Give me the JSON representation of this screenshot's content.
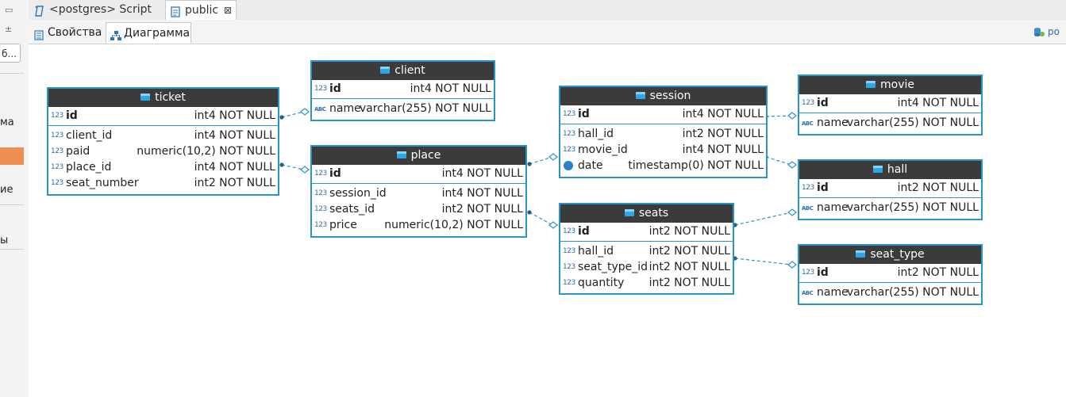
{
  "editor_tabs": [
    {
      "label": "<postgres> Script"
    },
    {
      "label": "public",
      "close": "⊠"
    }
  ],
  "sub_tabs": [
    {
      "label": "Свойства"
    },
    {
      "label": "Диаграмма"
    }
  ],
  "right_label": "ро",
  "left_panel": {
    "input_value": "б...",
    "items": [
      "ма",
      "ие",
      "ы"
    ]
  },
  "type_icons": {
    "num": "123",
    "text": "ABC"
  },
  "entities": {
    "ticket": {
      "name": "ticket",
      "pk": {
        "name": "id",
        "type": "int4 NOT NULL"
      },
      "cols": [
        {
          "name": "client_id",
          "type": "int4 NOT NULL"
        },
        {
          "name": "paid",
          "type": "numeric(10,2) NOT NULL"
        },
        {
          "name": "place_id",
          "type": "int4 NOT NULL"
        },
        {
          "name": "seat_number",
          "type": "int2 NOT NULL"
        }
      ]
    },
    "client": {
      "name": "client",
      "pk": {
        "name": "id",
        "type": "int4 NOT NULL"
      },
      "cols": [
        {
          "name": "name",
          "type": "varchar(255) NOT NULL"
        }
      ]
    },
    "place": {
      "name": "place",
      "pk": {
        "name": "id",
        "type": "int4 NOT NULL"
      },
      "cols": [
        {
          "name": "session_id",
          "type": "int4 NOT NULL"
        },
        {
          "name": "seats_id",
          "type": "int2 NOT NULL"
        },
        {
          "name": "price",
          "type": "numeric(10,2) NOT NULL"
        }
      ]
    },
    "session": {
      "name": "session",
      "pk": {
        "name": "id",
        "type": "int4 NOT NULL"
      },
      "cols": [
        {
          "name": "hall_id",
          "type": "int2 NOT NULL"
        },
        {
          "name": "movie_id",
          "type": "int4 NOT NULL"
        },
        {
          "name": "date",
          "type": "timestamp(0) NOT NULL"
        }
      ]
    },
    "seats": {
      "name": "seats",
      "pk": {
        "name": "id",
        "type": "int2 NOT NULL"
      },
      "cols": [
        {
          "name": "hall_id",
          "type": "int2 NOT NULL"
        },
        {
          "name": "seat_type_id",
          "type": "int2 NOT NULL"
        },
        {
          "name": "quantity",
          "type": "int2 NOT NULL"
        }
      ]
    },
    "movie": {
      "name": "movie",
      "pk": {
        "name": "id",
        "type": "int4 NOT NULL"
      },
      "cols": [
        {
          "name": "name",
          "type": "varchar(255) NOT NULL"
        }
      ]
    },
    "hall": {
      "name": "hall",
      "pk": {
        "name": "id",
        "type": "int2 NOT NULL"
      },
      "cols": [
        {
          "name": "name",
          "type": "varchar(255) NOT NULL"
        }
      ]
    },
    "seat_type": {
      "name": "seat_type",
      "pk": {
        "name": "id",
        "type": "int2 NOT NULL"
      },
      "cols": [
        {
          "name": "name",
          "type": "varchar(255) NOT NULL"
        }
      ]
    }
  }
}
